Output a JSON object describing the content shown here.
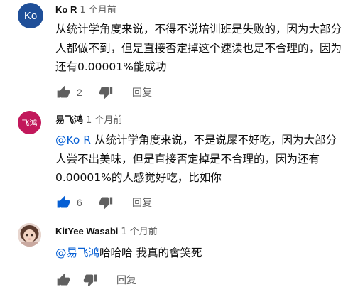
{
  "colors": {
    "accent_blue": "#065fd4",
    "icon_gray": "#606060",
    "avatar_ko": "#1f4f99",
    "avatar_yi": "#c2185b"
  },
  "comments": [
    {
      "avatar_text": "Ko",
      "author": "Ko R",
      "time": "1 个月前",
      "mention": "",
      "text": "从统计学角度来说，不得不说培训班是失败的，因为大部分人都做不到，但是直接否定掉这个速读也是不合理的，因为还有0.00001%能成功",
      "likes": "2",
      "liked": false,
      "reply": "回复"
    },
    {
      "avatar_text": "飞鸿",
      "author": "易飞鸿",
      "time": "1 个月前",
      "mention": "@Ko R",
      "text": " 从统计学角度来说，不是说屎不好吃，因为大部分人尝不出美味，但是直接否定掉是不合理的，因为还有0.00001%的人感觉好吃，比如你",
      "likes": "6",
      "liked": true,
      "reply": "回复"
    },
    {
      "avatar_text": "",
      "author": "KitYee Wasabi",
      "time": "1 个月前",
      "mention": "@易飞鸿",
      "text": "哈哈哈 我真的會笑死",
      "likes": "",
      "liked": false,
      "reply": "回复"
    }
  ]
}
